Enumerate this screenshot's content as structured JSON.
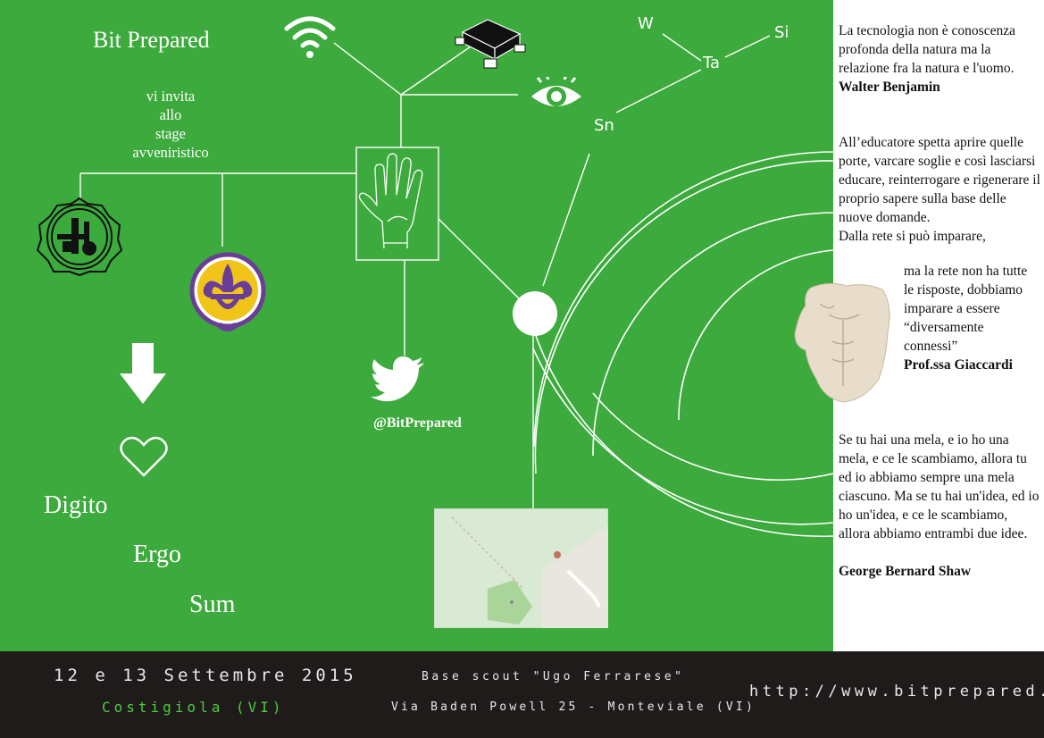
{
  "brand": {
    "title": "Bit Prepared",
    "invite_lines": [
      "vi invita",
      "allo",
      "stage",
      "avveniristico"
    ],
    "twitter_handle": "@BitPrepared"
  },
  "motto": [
    "Digito",
    "Ergo",
    "Sum"
  ],
  "elements": {
    "w": "W",
    "ta": "Ta",
    "si": "Si",
    "sn": "Sn"
  },
  "quotes": {
    "benjamin": {
      "text": "La tecnologia non è conoscenza profonda della natura ma la relazione fra la natura e l'uomo.",
      "author": "Walter Benjamin"
    },
    "giaccardi": {
      "text_top": "All’educatore spetta aprire quelle porte, varcare soglie e così lasciarsi educare, reinterrogare e rigenerare il proprio sapere sulla base delle nuove domande.",
      "text_mid": "Dalla rete si può imparare,",
      "text_indent": "ma la rete non ha tutte le risposte, dobbiamo imparare a essere “diversamente connessi”",
      "author": "Prof.ssa Giaccardi"
    },
    "shaw": {
      "text": "Se tu hai una mela, e io ho una mela, e ce le scambiamo, allora tu ed io abbiamo sempre una mela ciascuno. Ma se tu hai un'idea, ed io ho un'idea, e ce le scambiamo, allora abbiamo entrambi due idee.",
      "author": "George Bernard Shaw"
    }
  },
  "footer": {
    "date": "12 e 13 Settembre 2015",
    "town": "Costigiola (VI)",
    "base_name": "Base scout \"Ugo Ferrarese\"",
    "address": "Via Baden Powell 25 - Monteviale (VI)",
    "website": "http://www.bitprepared.it"
  },
  "colors": {
    "green": "#3caa3c",
    "footer_bg": "#1f1b1b",
    "footer_text": "#e8e8e8",
    "town_text": "#4ccd3c",
    "scout_purple": "#6a3d96",
    "scout_yellow": "#f0c419"
  },
  "icons": [
    "wifi-icon",
    "chip-icon",
    "eye-icon",
    "hand-icon",
    "twitter-icon",
    "arrow-down-icon",
    "heart-icon",
    "scout-emblem-icon",
    "agesci-emblem-icon",
    "torso-statue-image",
    "map-image"
  ]
}
